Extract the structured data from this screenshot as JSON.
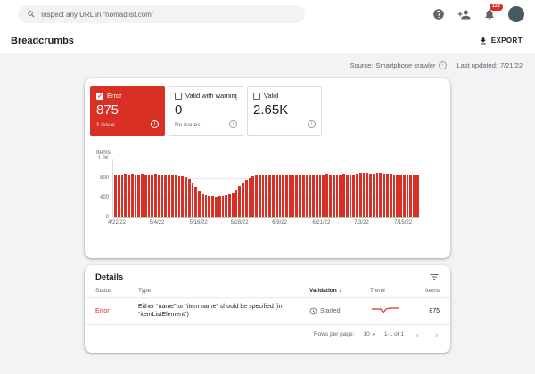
{
  "topbar": {
    "search_placeholder": "Inspect any URL in “nomadlist.com”",
    "badge_count": "122"
  },
  "header": {
    "title": "Breadcrumbs",
    "export_label": "EXPORT"
  },
  "meta": {
    "source_label": "Source:",
    "source_value": "Smartphone crawler",
    "updated_label": "Last updated:",
    "updated_value": "7/21/22"
  },
  "cards": [
    {
      "label": "Error",
      "value": "875",
      "sub": "1 issue",
      "selected": true
    },
    {
      "label": "Valid with warning",
      "value": "0",
      "sub": "No issues",
      "selected": false
    },
    {
      "label": "Valid",
      "value": "2.65K",
      "sub": "",
      "selected": false
    }
  ],
  "colors": {
    "error_red": "#d93025",
    "bar_red": "#d93025",
    "badge_red": "#d93025",
    "text_dark": "#202124",
    "text_gray": "#5f6368"
  },
  "chart_data": {
    "type": "bar",
    "title": "",
    "xlabel": "",
    "ylabel": "Items",
    "ylim": [
      0,
      1200
    ],
    "grid": true,
    "bar_color": "#d93025",
    "yticks": [
      {
        "label": "1.2K",
        "value": 1200
      },
      {
        "label": "800",
        "value": 800
      },
      {
        "label": "400",
        "value": 400
      },
      {
        "label": "0",
        "value": 0
      }
    ],
    "xticks": [
      {
        "label": "4/22/22",
        "index": 0
      },
      {
        "label": "5/4/22",
        "index": 12
      },
      {
        "label": "5/16/22",
        "index": 24
      },
      {
        "label": "5/28/22",
        "index": 36
      },
      {
        "label": "6/9/22",
        "index": 48
      },
      {
        "label": "6/21/22",
        "index": 60
      },
      {
        "label": "7/3/22",
        "index": 72
      },
      {
        "label": "7/15/22",
        "index": 84
      }
    ],
    "values": [
      860,
      880,
      870,
      890,
      875,
      885,
      870,
      880,
      890,
      875,
      865,
      880,
      885,
      870,
      860,
      875,
      880,
      865,
      850,
      840,
      830,
      820,
      780,
      700,
      620,
      540,
      480,
      450,
      440,
      430,
      425,
      430,
      440,
      455,
      470,
      500,
      560,
      640,
      700,
      760,
      800,
      830,
      850,
      860,
      865,
      870,
      860,
      870,
      875,
      865,
      870,
      880,
      870,
      860,
      875,
      880,
      870,
      865,
      875,
      880,
      870,
      860,
      875,
      885,
      875,
      865,
      870,
      880,
      890,
      880,
      870,
      880,
      900,
      910,
      905,
      915,
      900,
      895,
      905,
      910,
      900,
      890,
      885,
      880,
      875,
      880,
      870,
      865,
      870,
      875,
      875
    ]
  },
  "details": {
    "title": "Details",
    "columns": [
      "Status",
      "Type",
      "Validation",
      "Trend",
      "Items"
    ],
    "sort_icon": "↓",
    "rows": [
      {
        "status": "Error",
        "type": "Either “name” or “item name” should be specified (in “itemListElement”)",
        "validation": "Started",
        "items": "875"
      }
    ],
    "pagination": {
      "rows_per_page_label": "Rows per page:",
      "rows_per_page_value": "10",
      "range": "1-1 of 1"
    }
  }
}
